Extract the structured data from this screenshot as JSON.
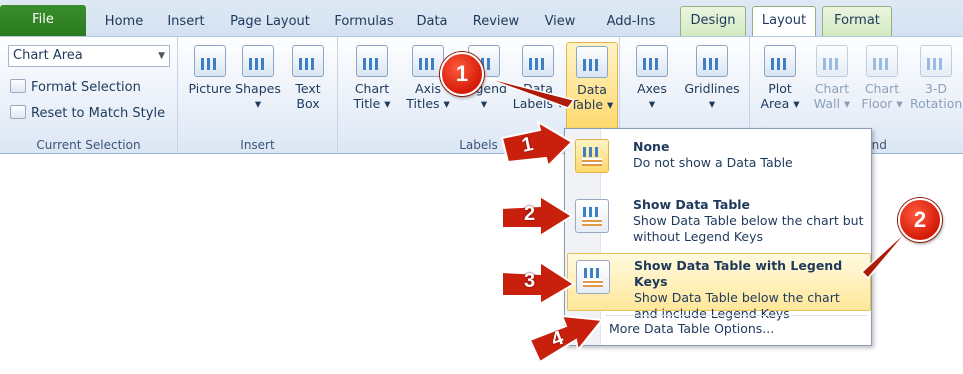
{
  "tabs": [
    "File",
    "Home",
    "Insert",
    "Page Layout",
    "Formulas",
    "Data",
    "Review",
    "View",
    "Add-Ins",
    "Design",
    "Layout",
    "Format"
  ],
  "current_selection": {
    "combo_value": "Chart Area",
    "format_selection": "Format Selection",
    "reset_style": "Reset to Match Style",
    "group_label": "Current Selection"
  },
  "insert_group": {
    "picture": "Picture",
    "shapes": "Shapes",
    "text_box_line1": "Text",
    "text_box_line2": "Box",
    "group_label": "Insert"
  },
  "labels_group": {
    "chart_title_1": "Chart",
    "chart_title_2": "Title ▾",
    "axis_titles_1": "Axis",
    "axis_titles_2": "Titles ▾",
    "legend": "Legend",
    "data_labels_1": "Data",
    "data_labels_2": "Labels ▾",
    "data_table_1": "Data",
    "data_table_2": "Table ▾",
    "group_label": "Labels"
  },
  "axes_group": {
    "axes": "Axes",
    "gridlines": "Gridlines"
  },
  "background_group": {
    "plot_area_1": "Plot",
    "plot_area_2": "Area ▾",
    "chart_wall_1": "Chart",
    "chart_wall_2": "Wall ▾",
    "chart_floor_1": "Chart",
    "chart_floor_2": "Floor ▾",
    "rotation_1": "3-D",
    "rotation_2": "Rotation",
    "group_label_partial": "und"
  },
  "menu": {
    "none_title": "None",
    "none_desc": "Do not show a Data Table",
    "show_title": "Show Data Table",
    "show_desc1": "Show Data Table below the chart but",
    "show_desc2": "without Legend Keys",
    "keys_title": "Show Data Table with Legend Keys",
    "keys_desc1": "Show Data Table below the chart",
    "keys_desc2": "and include Legend Keys",
    "more": "More Data Table Options..."
  },
  "callouts": {
    "circle1": "1",
    "circle2": "2",
    "arrow1": "1",
    "arrow2": "2",
    "arrow3": "3",
    "arrow4": "4"
  },
  "colors": {
    "file_tab": "#2a7a1e",
    "callout_red": "#d41a08",
    "highlight": "#ffd86b"
  }
}
